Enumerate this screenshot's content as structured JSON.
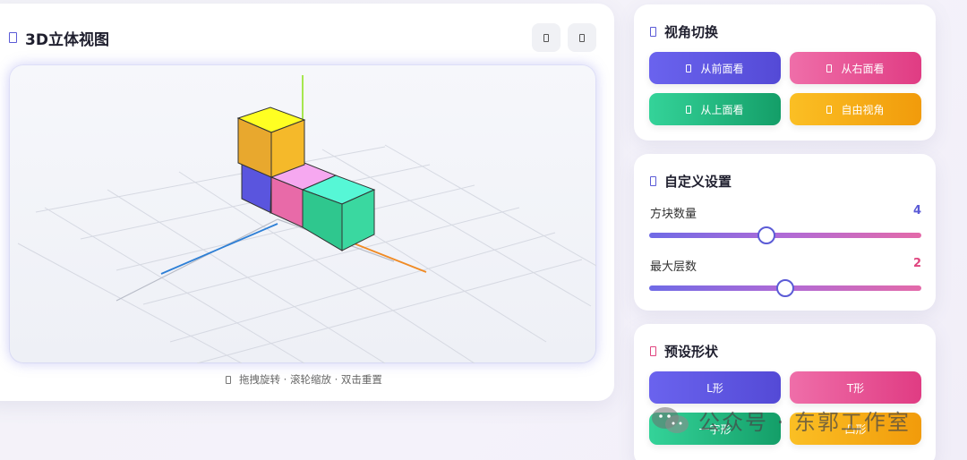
{
  "main": {
    "title": "3D立体视图",
    "hint": "拖拽旋转 · 滚轮缩放 · 双击重置",
    "header_buttons": [
      {
        "icon": "camera-icon"
      },
      {
        "icon": "fullscreen-icon"
      }
    ]
  },
  "scene": {
    "axis_colors": {
      "x": "#f08a24",
      "y": "#9ee53c",
      "z": "#2d7fd6"
    },
    "cubes": [
      {
        "color_top": "#ffff22",
        "color_left": "#e8a82e",
        "color_right": "#f5b92a",
        "layer": 2
      },
      {
        "color_top": "#7a72f5",
        "color_left": "#5a55de",
        "color_right": "#6a64ea",
        "layer": 1
      },
      {
        "color_top": "#f6a8f0",
        "color_left": "#e86aa8",
        "color_right": "#ee7fb8",
        "layer": 1
      },
      {
        "color_top": "#56f7d6",
        "color_left": "#2fc78e",
        "color_right": "#3ad8a0",
        "layer": 1
      }
    ]
  },
  "view_card": {
    "title": "视角切换",
    "buttons": [
      {
        "label": "从前面看",
        "gradient": "purple"
      },
      {
        "label": "从右面看",
        "gradient": "pink"
      },
      {
        "label": "从上面看",
        "gradient": "green"
      },
      {
        "label": "自由视角",
        "gradient": "yellow"
      }
    ]
  },
  "custom_card": {
    "title": "自定义设置",
    "sliders": [
      {
        "label": "方块数量",
        "value": "4",
        "value_color": "#5b5bd6",
        "fraction": 0.43
      },
      {
        "label": "最大层数",
        "value": "2",
        "value_color": "#e0457f",
        "fraction": 0.5
      }
    ]
  },
  "preset_card": {
    "title": "预设形状",
    "buttons": [
      {
        "label": "L形",
        "gradient": "purple"
      },
      {
        "label": "T形",
        "gradient": "pink"
      },
      {
        "label": "一字形",
        "gradient": "green"
      },
      {
        "label": "凸形",
        "gradient": "yellow"
      }
    ]
  },
  "watermark": {
    "text": "公众号 · 东郭工作室"
  }
}
